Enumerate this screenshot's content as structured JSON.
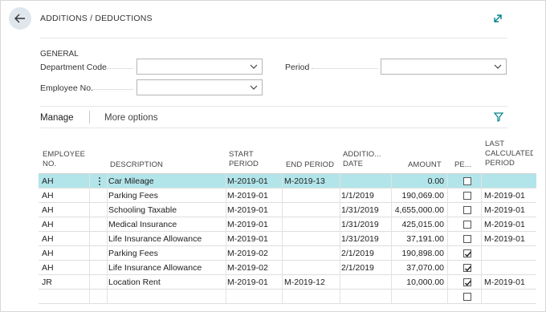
{
  "page": {
    "title": "ADDITIONS / DEDUCTIONS"
  },
  "icons": {
    "back": "arrow-left-icon",
    "expand": "expand-icon",
    "filter": "filter-icon",
    "dropdown": "chevron-down-icon",
    "row_actions": "vertical-ellipsis-icon"
  },
  "colors": {
    "accent": "#00848c",
    "selected_row": "#b2e5ea",
    "back_button_bg": "#dfe6ec"
  },
  "general": {
    "heading": "GENERAL",
    "department_code": {
      "label": "Department Code",
      "value": ""
    },
    "employee_no": {
      "label": "Employee No.",
      "value": ""
    },
    "period": {
      "label": "Period",
      "value": ""
    }
  },
  "actions": {
    "manage": "Manage",
    "more_options": "More options"
  },
  "table": {
    "headers": {
      "employee_no_1": "EMPLOYEE",
      "employee_no_2": "NO.",
      "description": "DESCRIPTION",
      "start_period_1": "START",
      "start_period_2": "PERIOD",
      "end_period": "END PERIOD",
      "addition_date_1": "ADDITIO...",
      "addition_date_2": "DATE",
      "amount": "AMOUNT",
      "pe": "PE...",
      "last_calc_1": "LAST",
      "last_calc_2": "CALCULATED",
      "last_calc_3": "PERIOD"
    },
    "rows": [
      {
        "employee": "AH",
        "description": "Car Mileage",
        "start": "M-2019-01",
        "end": "M-2019-13",
        "date": "",
        "amount": "0.00",
        "checked": false,
        "last": "",
        "selected": true
      },
      {
        "employee": "AH",
        "description": "Parking Fees",
        "start": "M-2019-01",
        "end": "",
        "date": "1/1/2019",
        "amount": "190,069.00",
        "checked": false,
        "last": "M-2019-01",
        "selected": false
      },
      {
        "employee": "AH",
        "description": "Schooling Taxable",
        "start": "M-2019-01",
        "end": "",
        "date": "1/31/2019",
        "amount": "4,655,000.00",
        "checked": false,
        "last": "M-2019-01",
        "selected": false
      },
      {
        "employee": "AH",
        "description": "Medical Insurance",
        "start": "M-2019-01",
        "end": "",
        "date": "1/31/2019",
        "amount": "425,015.00",
        "checked": false,
        "last": "M-2019-01",
        "selected": false
      },
      {
        "employee": "AH",
        "description": "Life Insurance Allowance",
        "start": "M-2019-01",
        "end": "",
        "date": "1/31/2019",
        "amount": "37,191.00",
        "checked": false,
        "last": "M-2019-01",
        "selected": false
      },
      {
        "employee": "AH",
        "description": "Parking Fees",
        "start": "M-2019-02",
        "end": "",
        "date": "2/1/2019",
        "amount": "190,898.00",
        "checked": true,
        "last": "",
        "selected": false
      },
      {
        "employee": "AH",
        "description": "Life Insurance Allowance",
        "start": "M-2019-02",
        "end": "",
        "date": "2/1/2019",
        "amount": "37,070.00",
        "checked": true,
        "last": "",
        "selected": false
      },
      {
        "employee": "JR",
        "description": "Location Rent",
        "start": "M-2019-01",
        "end": "M-2019-12",
        "date": "",
        "amount": "10,000.00",
        "checked": true,
        "last": "M-2019-01",
        "selected": false
      },
      {
        "employee": "",
        "description": "",
        "start": "",
        "end": "",
        "date": "",
        "amount": "",
        "checked": false,
        "last": "",
        "selected": false
      }
    ]
  }
}
